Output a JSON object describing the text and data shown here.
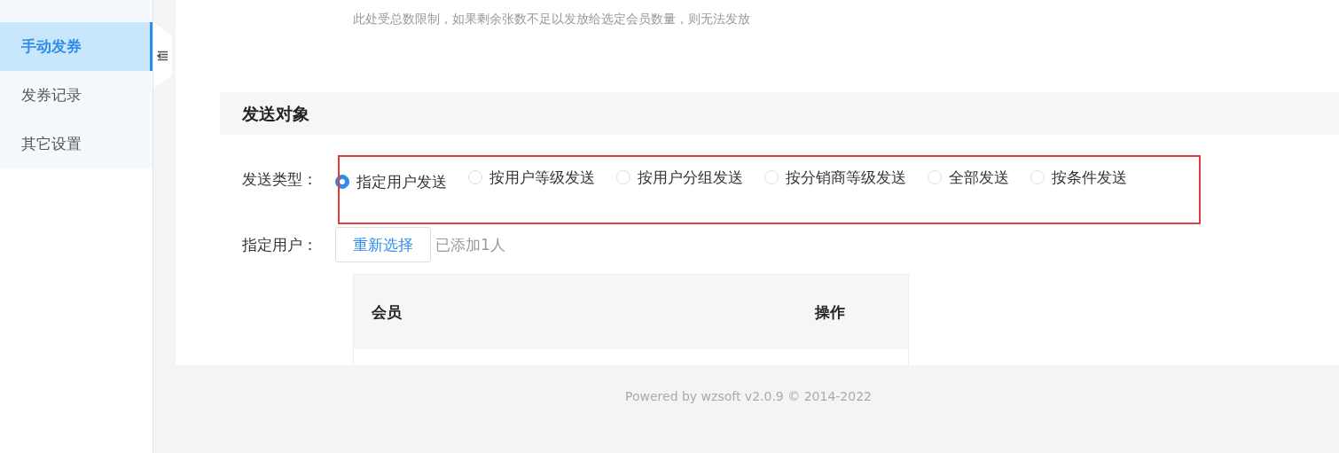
{
  "sidebar": {
    "items": [
      {
        "label": "手动发券",
        "selected": true
      },
      {
        "label": "发券记录",
        "selected": false
      },
      {
        "label": "其它设置",
        "selected": false
      }
    ]
  },
  "hint": "此处受总数限制，如果剩余张数不足以发放给选定会员数量，则无法发放",
  "section": {
    "title": "发送对象"
  },
  "send_type": {
    "label": "发送类型：",
    "options": [
      {
        "label": "指定用户发送",
        "selected": true
      },
      {
        "label": "按用户等级发送",
        "selected": false
      },
      {
        "label": "按用户分组发送",
        "selected": false
      },
      {
        "label": "按分销商等级发送",
        "selected": false
      },
      {
        "label": "全部发送",
        "selected": false
      },
      {
        "label": "按条件发送",
        "selected": false
      }
    ]
  },
  "specified_user": {
    "label": "指定用户：",
    "button": "重新选择",
    "count": "已添加1人"
  },
  "table": {
    "columns": [
      "会员",
      "操作"
    ]
  },
  "footer": "Powered by wzsoft v2.0.9 © 2014-2022"
}
